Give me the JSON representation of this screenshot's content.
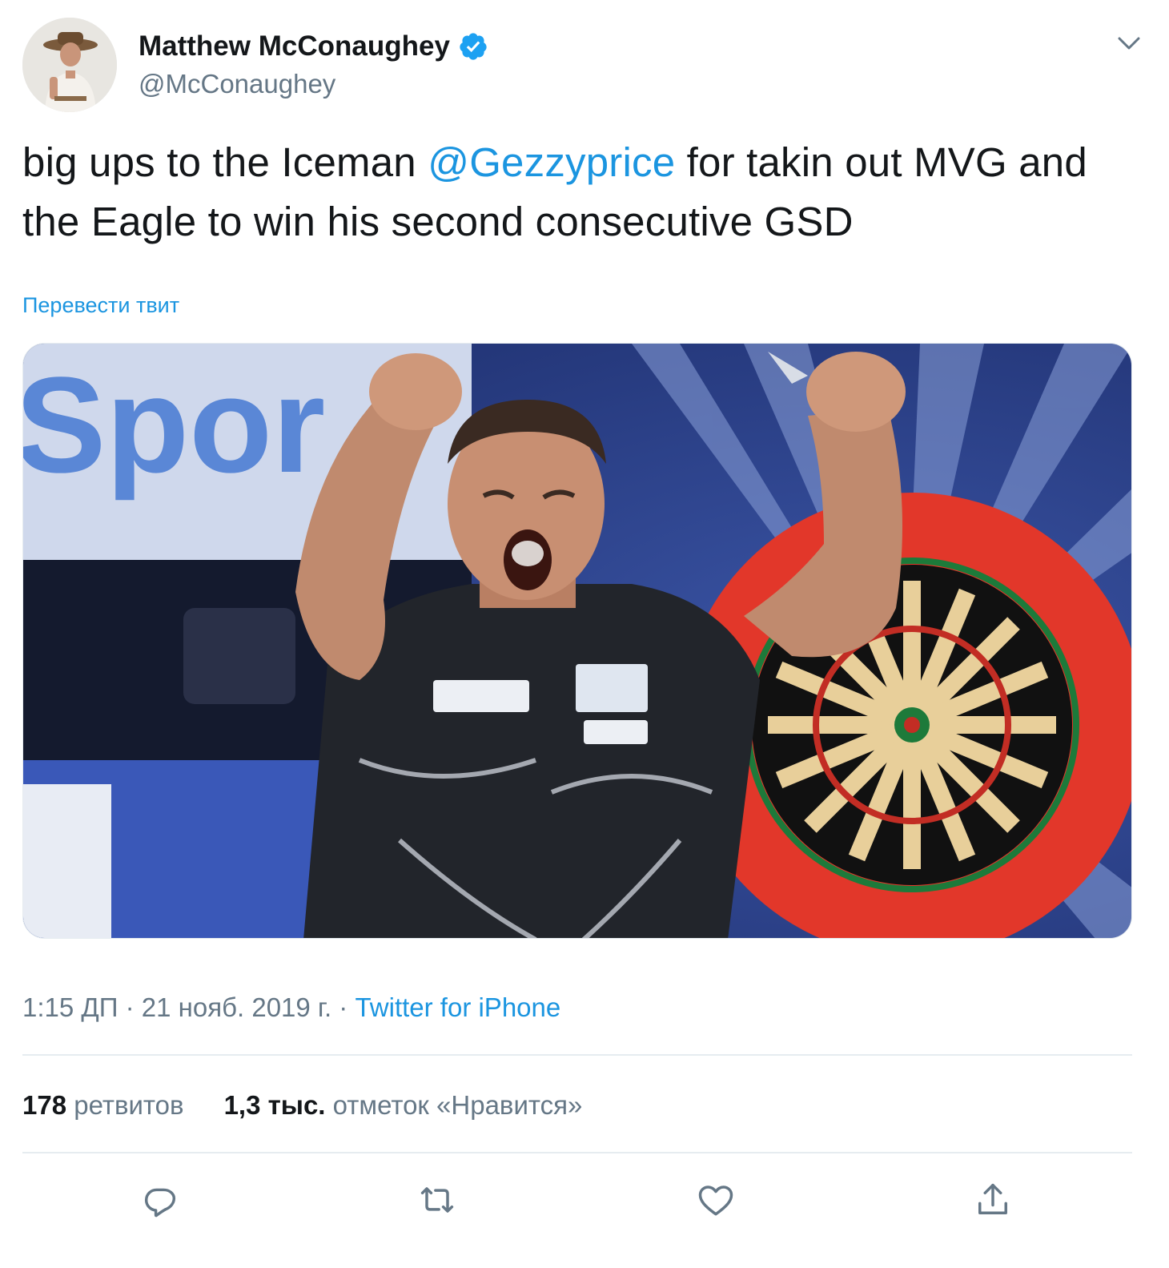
{
  "author": {
    "display_name": "Matthew McConaughey",
    "handle": "@McConaughey",
    "verified": true
  },
  "tweet": {
    "text_before": "big ups to the Iceman ",
    "mention": "@Gezzyprice",
    "text_after": " for takin out MVG and the Eagle to win his second consecutive GSD",
    "translate_label": "Перевести твит",
    "image_sign_text": "Spor"
  },
  "meta": {
    "time": "1:15 ДП",
    "separator1": " · ",
    "date": "21 нояб. 2019 г.",
    "separator2": " · ",
    "source": "Twitter for iPhone"
  },
  "stats": {
    "retweets_count": "178",
    "retweets_label": " ретвитов",
    "likes_count": "1,3 тыс.",
    "likes_label": " отметок «Нравится»"
  },
  "actions": [
    "reply-icon",
    "retweet-icon",
    "like-icon",
    "share-icon"
  ],
  "colors": {
    "accent": "#1b95e0",
    "verified": "#1da1f2",
    "text": "#14171a",
    "secondary": "#657786",
    "divider": "#e6ecf0"
  }
}
